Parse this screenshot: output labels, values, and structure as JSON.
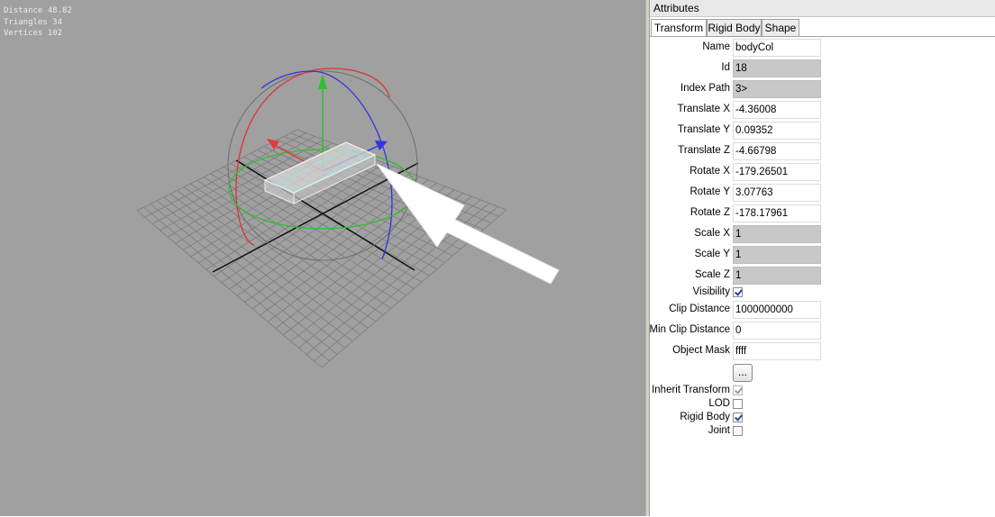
{
  "viewport": {
    "stats": {
      "distance": "Distance 48.82",
      "triangles": "Triangles 34",
      "vertices": "Vertices 102"
    },
    "gizmo_colors": {
      "x_axis": "#e03c3c",
      "y_axis": "#2fbf2f",
      "z_axis": "#3434e0",
      "grid": "#7c7c7c"
    }
  },
  "panel": {
    "title": "Attributes",
    "tabs": [
      "Transform",
      "Rigid Body",
      "Shape"
    ],
    "active_tab": "Transform",
    "fields": [
      {
        "label": "Name",
        "value": "bodyCol",
        "readonly": false
      },
      {
        "label": "Id",
        "value": "18",
        "readonly": true
      },
      {
        "label": "Index Path",
        "value": "3>",
        "readonly": true
      },
      {
        "label": "Translate X",
        "value": "-4.36008",
        "readonly": false
      },
      {
        "label": "Translate Y",
        "value": "0.09352",
        "readonly": false
      },
      {
        "label": "Translate Z",
        "value": "-4.66798",
        "readonly": false
      },
      {
        "label": "Rotate X",
        "value": "-179.26501",
        "readonly": false
      },
      {
        "label": "Rotate Y",
        "value": "3.07763",
        "readonly": false
      },
      {
        "label": "Rotate Z",
        "value": "-178.17961",
        "readonly": false
      },
      {
        "label": "Scale X",
        "value": "1",
        "readonly": true
      },
      {
        "label": "Scale Y",
        "value": "1",
        "readonly": true
      },
      {
        "label": "Scale Z",
        "value": "1",
        "readonly": true
      }
    ],
    "visibility": {
      "label": "Visibility",
      "checked": true
    },
    "clip_distance": {
      "label": "Clip Distance",
      "value": "1000000000"
    },
    "min_clip_distance": {
      "label": "Min Clip Distance",
      "value": "0"
    },
    "object_mask": {
      "label": "Object Mask",
      "value": "ffff"
    },
    "more_button": "...",
    "flags": [
      {
        "label": "Inherit Transform",
        "checked": true,
        "disabled": true
      },
      {
        "label": "LOD",
        "checked": false,
        "disabled": false
      },
      {
        "label": "Rigid Body",
        "checked": true,
        "disabled": false
      },
      {
        "label": "Joint",
        "checked": false,
        "disabled": false
      }
    ]
  }
}
